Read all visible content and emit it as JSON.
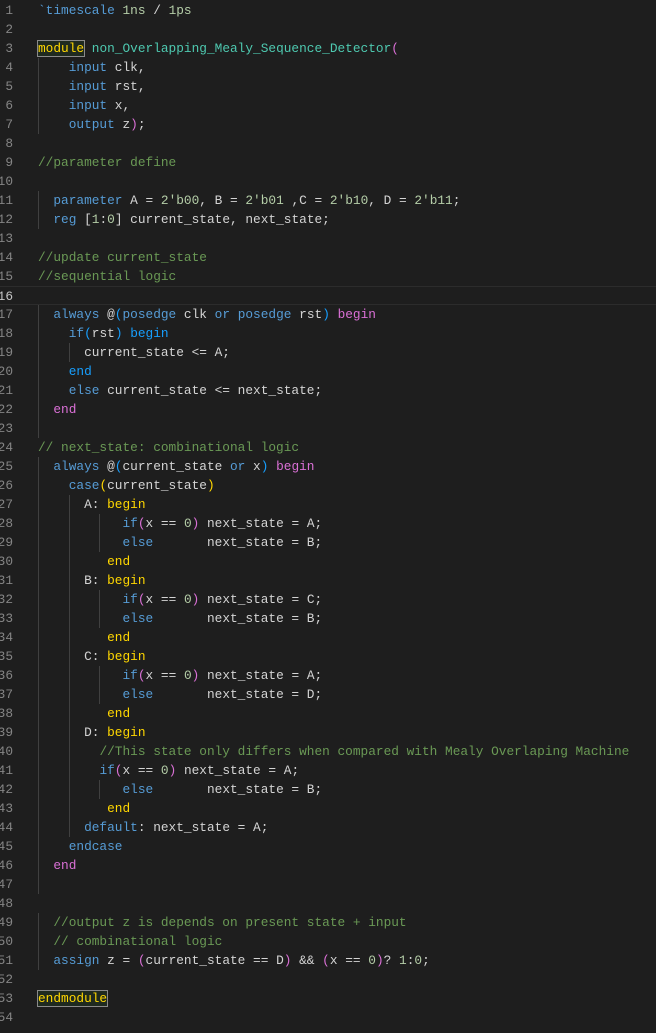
{
  "editor": {
    "language": "verilog",
    "current_line": 16,
    "colors": {
      "background": "#1e1e1e",
      "keyword": "#569cd6",
      "type": "#4ec9b0",
      "number": "#b5cea8",
      "comment": "#6a9955",
      "text": "#d4d4d4",
      "bracket1": "#ffd700",
      "bracket2": "#da70d6",
      "bracket3": "#179fff"
    },
    "lines": [
      [
        [
          "`timescale",
          "k"
        ],
        [
          " ",
          "p"
        ],
        [
          "1ns",
          "n"
        ],
        [
          " / ",
          "p"
        ],
        [
          "1ps",
          "n"
        ]
      ],
      [],
      [
        [
          "module",
          "hl"
        ],
        [
          " ",
          "p"
        ],
        [
          "non_Overlapping_Mealy_Sequence_Detector",
          "t"
        ],
        [
          "(",
          "m"
        ]
      ],
      [
        [
          "    ",
          "p"
        ],
        [
          "input",
          "k"
        ],
        [
          " clk,",
          "p"
        ]
      ],
      [
        [
          "    ",
          "p"
        ],
        [
          "input",
          "k"
        ],
        [
          " rst,",
          "p"
        ]
      ],
      [
        [
          "    ",
          "p"
        ],
        [
          "input",
          "k"
        ],
        [
          " x,",
          "p"
        ]
      ],
      [
        [
          "    ",
          "p"
        ],
        [
          "output",
          "k"
        ],
        [
          " z",
          "p"
        ],
        [
          ")",
          "m"
        ],
        [
          ";",
          "p"
        ]
      ],
      [],
      [
        [
          "//parameter define",
          "c"
        ]
      ],
      [],
      [
        [
          "  ",
          "p"
        ],
        [
          "parameter",
          "k"
        ],
        [
          " A = ",
          "p"
        ],
        [
          "2'b00",
          "n"
        ],
        [
          ", B = ",
          "p"
        ],
        [
          "2'b01",
          "n"
        ],
        [
          " ,C = ",
          "p"
        ],
        [
          "2'b10",
          "n"
        ],
        [
          ", D = ",
          "p"
        ],
        [
          "2'b11",
          "n"
        ],
        [
          ";",
          "p"
        ]
      ],
      [
        [
          "  ",
          "p"
        ],
        [
          "reg",
          "k"
        ],
        [
          " [",
          "p"
        ],
        [
          "1",
          "n"
        ],
        [
          ":",
          "p"
        ],
        [
          "0",
          "n"
        ],
        [
          "] current_state, next_state;",
          "p"
        ]
      ],
      [],
      [
        [
          "//update current_state",
          "c"
        ]
      ],
      [
        [
          "//sequential logic",
          "c"
        ]
      ],
      [],
      [
        [
          "  ",
          "p"
        ],
        [
          "always",
          "k"
        ],
        [
          " @",
          "p"
        ],
        [
          "(",
          "b"
        ],
        [
          "posedge",
          "k"
        ],
        [
          " clk ",
          "p"
        ],
        [
          "or",
          "k"
        ],
        [
          " ",
          "p"
        ],
        [
          "posedge",
          "k"
        ],
        [
          " rst",
          "p"
        ],
        [
          ")",
          "b"
        ],
        [
          " ",
          "p"
        ],
        [
          "begin",
          "m"
        ]
      ],
      [
        [
          "    ",
          "p"
        ],
        [
          "if",
          "k"
        ],
        [
          "(",
          "b"
        ],
        [
          "rst",
          "p"
        ],
        [
          ")",
          "b"
        ],
        [
          " ",
          "p"
        ],
        [
          "begin",
          "b"
        ]
      ],
      [
        [
          "      current_state <= A;",
          "p"
        ]
      ],
      [
        [
          "    ",
          "p"
        ],
        [
          "end",
          "b"
        ]
      ],
      [
        [
          "    ",
          "p"
        ],
        [
          "else",
          "k"
        ],
        [
          " current_state <= next_state;",
          "p"
        ]
      ],
      [
        [
          "  ",
          "p"
        ],
        [
          "end",
          "m"
        ]
      ],
      [],
      [
        [
          "// next_state: combinational logic",
          "c"
        ]
      ],
      [
        [
          "  ",
          "p"
        ],
        [
          "always",
          "k"
        ],
        [
          " @",
          "p"
        ],
        [
          "(",
          "b"
        ],
        [
          "current_state ",
          "p"
        ],
        [
          "or",
          "k"
        ],
        [
          " x",
          "p"
        ],
        [
          ")",
          "b"
        ],
        [
          " ",
          "p"
        ],
        [
          "begin",
          "m"
        ]
      ],
      [
        [
          "    ",
          "p"
        ],
        [
          "case",
          "k"
        ],
        [
          "(",
          "y"
        ],
        [
          "current_state",
          "p"
        ],
        [
          ")",
          "y"
        ]
      ],
      [
        [
          "      A: ",
          "p"
        ],
        [
          "begin",
          "y"
        ]
      ],
      [
        [
          "           ",
          "p"
        ],
        [
          "if",
          "k"
        ],
        [
          "(",
          "m"
        ],
        [
          "x == ",
          "p"
        ],
        [
          "0",
          "n"
        ],
        [
          ")",
          "m"
        ],
        [
          " next_state = A;",
          "p"
        ]
      ],
      [
        [
          "           ",
          "p"
        ],
        [
          "else",
          "k"
        ],
        [
          "       next_state = B;",
          "p"
        ]
      ],
      [
        [
          "         ",
          "p"
        ],
        [
          "end",
          "y"
        ]
      ],
      [
        [
          "      B: ",
          "p"
        ],
        [
          "begin",
          "y"
        ]
      ],
      [
        [
          "           ",
          "p"
        ],
        [
          "if",
          "k"
        ],
        [
          "(",
          "m"
        ],
        [
          "x == ",
          "p"
        ],
        [
          "0",
          "n"
        ],
        [
          ")",
          "m"
        ],
        [
          " next_state = C;",
          "p"
        ]
      ],
      [
        [
          "           ",
          "p"
        ],
        [
          "else",
          "k"
        ],
        [
          "       next_state = B;",
          "p"
        ]
      ],
      [
        [
          "         ",
          "p"
        ],
        [
          "end",
          "y"
        ]
      ],
      [
        [
          "      C: ",
          "p"
        ],
        [
          "begin",
          "y"
        ]
      ],
      [
        [
          "           ",
          "p"
        ],
        [
          "if",
          "k"
        ],
        [
          "(",
          "m"
        ],
        [
          "x == ",
          "p"
        ],
        [
          "0",
          "n"
        ],
        [
          ")",
          "m"
        ],
        [
          " next_state = A;",
          "p"
        ]
      ],
      [
        [
          "           ",
          "p"
        ],
        [
          "else",
          "k"
        ],
        [
          "       next_state = D;",
          "p"
        ]
      ],
      [
        [
          "         ",
          "p"
        ],
        [
          "end",
          "y"
        ]
      ],
      [
        [
          "      D: ",
          "p"
        ],
        [
          "begin",
          "y"
        ]
      ],
      [
        [
          "        ",
          "p"
        ],
        [
          "//This state only differs when compared with Mealy Overlaping Machine",
          "c"
        ]
      ],
      [
        [
          "        ",
          "p"
        ],
        [
          "if",
          "k"
        ],
        [
          "(",
          "m"
        ],
        [
          "x == ",
          "p"
        ],
        [
          "0",
          "n"
        ],
        [
          ")",
          "m"
        ],
        [
          " next_state = A;",
          "p"
        ]
      ],
      [
        [
          "           ",
          "p"
        ],
        [
          "else",
          "k"
        ],
        [
          "       next_state = B;",
          "p"
        ]
      ],
      [
        [
          "         ",
          "p"
        ],
        [
          "end",
          "y"
        ]
      ],
      [
        [
          "      ",
          "p"
        ],
        [
          "default",
          "k"
        ],
        [
          ": next_state = A;",
          "p"
        ]
      ],
      [
        [
          "    ",
          "p"
        ],
        [
          "endcase",
          "k"
        ]
      ],
      [
        [
          "  ",
          "p"
        ],
        [
          "end",
          "m"
        ]
      ],
      [],
      [],
      [
        [
          "  ",
          "p"
        ],
        [
          "//output z is depends on present state + input",
          "c"
        ]
      ],
      [
        [
          "  ",
          "p"
        ],
        [
          "// combinational logic",
          "c"
        ]
      ],
      [
        [
          "  ",
          "p"
        ],
        [
          "assign",
          "k"
        ],
        [
          " z = ",
          "p"
        ],
        [
          "(",
          "m"
        ],
        [
          "current_state == D",
          "p"
        ],
        [
          ")",
          "m"
        ],
        [
          " && ",
          "p"
        ],
        [
          "(",
          "m"
        ],
        [
          "x == ",
          "p"
        ],
        [
          "0",
          "n"
        ],
        [
          ")",
          "m"
        ],
        [
          "? ",
          "p"
        ],
        [
          "1",
          "n"
        ],
        [
          ":",
          "p"
        ],
        [
          "0",
          "n"
        ],
        [
          ";",
          "p"
        ]
      ],
      [],
      [
        [
          "endmodule",
          "hl"
        ]
      ],
      []
    ]
  }
}
